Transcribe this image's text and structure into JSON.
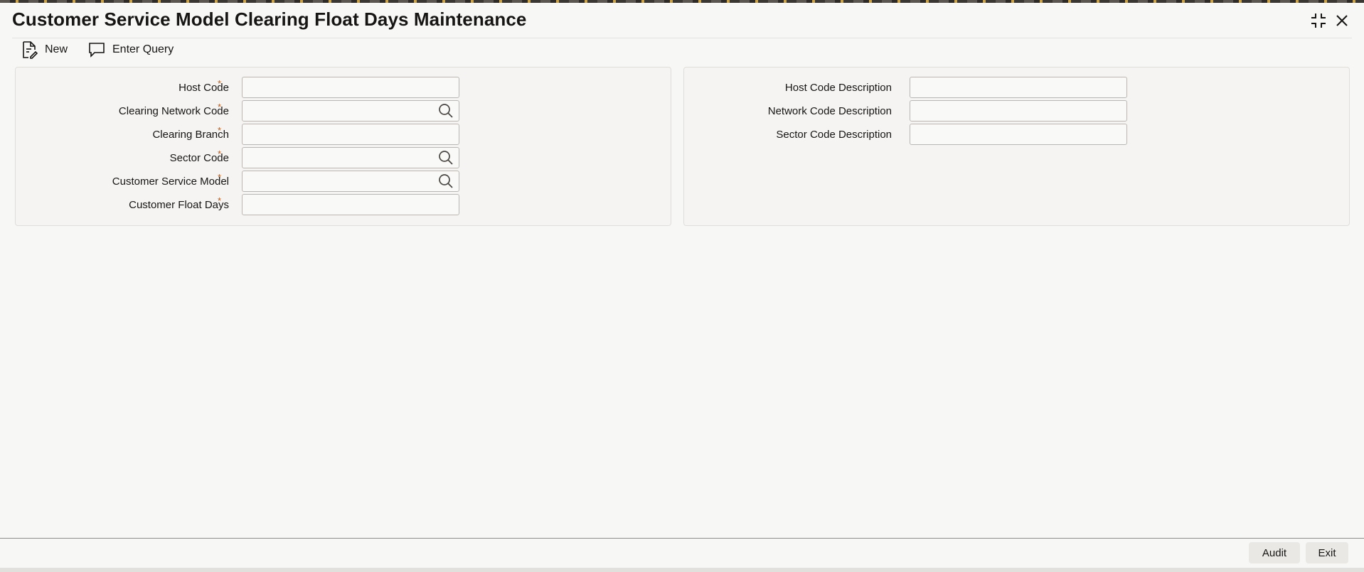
{
  "window": {
    "title": "Customer Service Model Clearing Float Days Maintenance",
    "maximize_icon": "maximize-icon",
    "close_icon": "close-icon"
  },
  "toolbar": {
    "new_label": "New",
    "new_icon": "new-document-icon",
    "enter_query_label": "Enter Query",
    "enter_query_icon": "speech-bubble-icon"
  },
  "left_panel": {
    "host_code": {
      "label": "Host Code",
      "required": "*",
      "value": ""
    },
    "clearing_network_code": {
      "label": "Clearing Network Code",
      "required": "*",
      "value": "",
      "lookup_icon": "search-icon"
    },
    "clearing_branch": {
      "label": "Clearing Branch",
      "required": "*",
      "value": ""
    },
    "sector_code": {
      "label": "Sector Code",
      "required": "*",
      "value": "",
      "lookup_icon": "search-icon"
    },
    "customer_service_model": {
      "label": "Customer Service Model",
      "required": "*",
      "value": "",
      "lookup_icon": "search-icon"
    },
    "customer_float_days": {
      "label": "Customer Float Days",
      "required": "*",
      "value": ""
    }
  },
  "right_panel": {
    "host_code_description": {
      "label": "Host Code Description",
      "value": ""
    },
    "network_code_description": {
      "label": "Network Code Description",
      "value": ""
    },
    "sector_code_description": {
      "label": "Sector Code Description",
      "value": ""
    }
  },
  "footer": {
    "audit_label": "Audit",
    "exit_label": "Exit"
  },
  "colors": {
    "required_marker": "#b55d1f",
    "background": "#f7f7f6",
    "panel": "#f5f4f2"
  }
}
